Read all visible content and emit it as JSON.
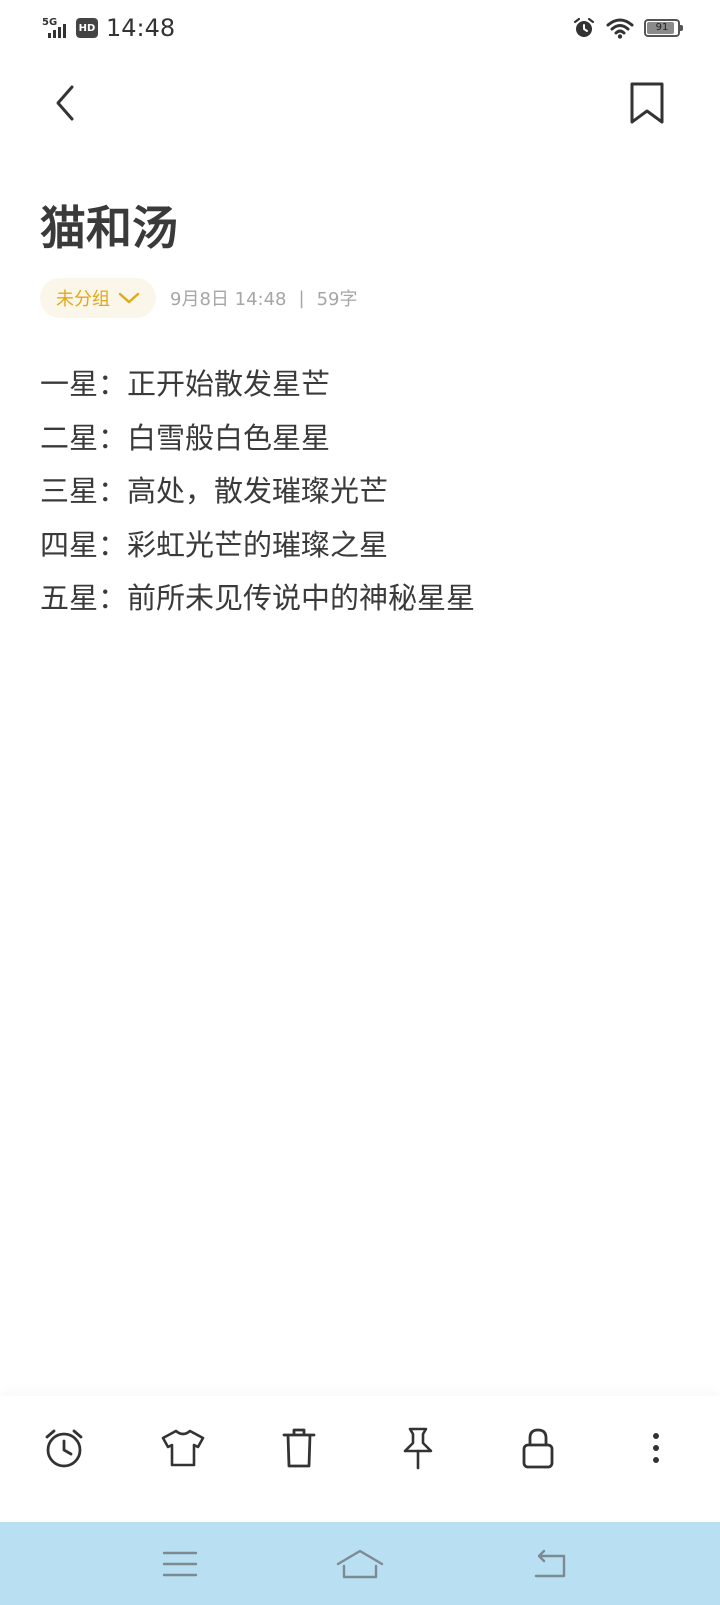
{
  "status_bar": {
    "network": "5G",
    "hd_badge": "HD",
    "time": "14:48",
    "battery_level": "91",
    "battery_fraction": 0.91,
    "icons": [
      "signal-icon",
      "hd-icon",
      "alarm-icon",
      "wifi-icon",
      "battery-icon"
    ]
  },
  "header": {
    "back_icon": "chevron-left-icon",
    "bookmark_icon": "bookmark-icon"
  },
  "note": {
    "title": "猫和汤",
    "group_label": "未分组",
    "date_time": "9月8日 14:48",
    "separator": "|",
    "word_count": "59字",
    "lines": [
      "一星：正开始散发星芒",
      "二星：白雪般白色星星",
      "三星：高处，散发璀璨光芒",
      "四星：彩虹光芒的璀璨之星",
      "五星：前所未见传说中的神秘星星"
    ]
  },
  "toolbar": {
    "items": [
      "alarm-icon",
      "theme-shirt-icon",
      "trash-icon",
      "pin-icon",
      "lock-icon",
      "more-icon"
    ]
  },
  "nav_bar": {
    "items": [
      "menu-icon",
      "home-icon",
      "back-icon"
    ]
  },
  "colors": {
    "accent": "#e2a917",
    "chip_bg": "#fbf6ea",
    "text": "#3a3a3a",
    "meta_text": "#a6a6a6",
    "nav_bg": "#b8dff2"
  }
}
